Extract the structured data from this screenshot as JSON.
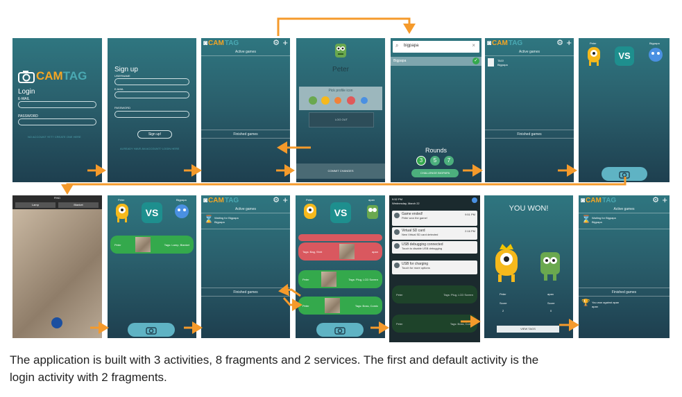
{
  "colors": {
    "accent_orange": "#f59a2b",
    "teal": "#2a6a76",
    "green": "#34a94c",
    "red": "#d9585f"
  },
  "brand": {
    "cam": "CAM",
    "tag": "TAG",
    "icon": "camera-icon"
  },
  "login": {
    "title": "Login",
    "email_label": "E-MAIL",
    "password_label": "PASSWORD",
    "create_hint": "NO ACCOUNT YET? CREATE ONE HERE"
  },
  "signup": {
    "title": "Sign up",
    "username_label": "USERNAME",
    "email_label": "E-MAIL",
    "password_label": "PASSWORD",
    "button": "Sign up!",
    "login_hint": "ALREADY HAVE AN ACCOUNT? LOGIN HERE"
  },
  "games": {
    "active": "Active games",
    "finished": "Finished games"
  },
  "profile": {
    "name": "Peter",
    "pick": "Pick profile icon",
    "logout": "LOG OUT",
    "commit": "COMMIT CHANGES"
  },
  "search": {
    "query": "bigpapa",
    "result": "Bigpapa",
    "rounds_label": "Rounds",
    "rounds": [
      "3",
      "5",
      "7"
    ],
    "challenge": "CHALLENGE BIGPAPA"
  },
  "game1": {
    "title": "TAG!",
    "sub": "Bigpapa"
  },
  "versus": {
    "vs": "VS",
    "left": "Peter",
    "right": "Bigpapa",
    "right2": "apan"
  },
  "camera": {
    "title": "FIND",
    "left": "Lamp",
    "right": "Blanket"
  },
  "waiting": {
    "title": "Waiting for Bigpapa",
    "sub": "Bigpapa"
  },
  "rounds_rows": [
    {
      "name": "Peter",
      "tags": "Tags: Lamp, Blanket"
    },
    {
      "name": "Tags: Bag, Shirt",
      "tags": "apan"
    },
    {
      "name": "Peter",
      "tags": "Tags: Plug, LCD Screen"
    },
    {
      "name": "Peter",
      "tags": "Tags: Boss, Comic"
    }
  ],
  "notifications": {
    "time": "9:52 PM",
    "date": "Wednesday, March 22",
    "items": [
      {
        "title": "Game ended!",
        "sub": "Peter won the game!",
        "time": "9:51 PM"
      },
      {
        "title": "Virtual SD card",
        "sub": "New Virtual SD card detected",
        "time": "2:16 PM"
      },
      {
        "title": "USB debugging connected",
        "sub": "Touch to disable USB debugging"
      },
      {
        "title": "USB for charging",
        "sub": "Touch for more options"
      }
    ]
  },
  "result": {
    "won": "YOU WON!",
    "p1": "Peter",
    "p2": "apan",
    "score_label": "Score",
    "s1": "2",
    "s2": "0",
    "view": "VIEW TAGS"
  },
  "finished_item": {
    "title": "You won against apan",
    "sub": "apan"
  },
  "caption": {
    "line1": "The application is built with 3 activities, 8 fragments and 2 services. The first and default activity is the",
    "line2": "login activity with 2 fragments."
  }
}
